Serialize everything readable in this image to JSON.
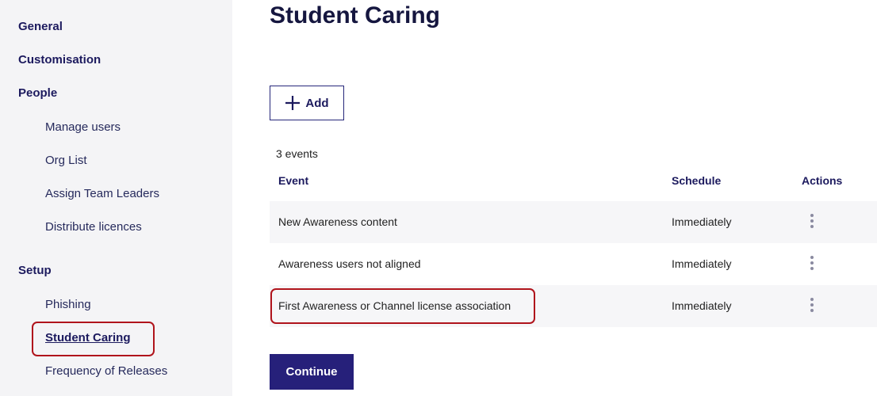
{
  "sidebar": {
    "sections": [
      {
        "label": "General"
      },
      {
        "label": "Customisation"
      },
      {
        "label": "People"
      },
      {
        "label": "Setup"
      }
    ],
    "items": [
      {
        "label": "Manage users"
      },
      {
        "label": "Org List"
      },
      {
        "label": "Assign Team Leaders"
      },
      {
        "label": "Distribute licences"
      },
      {
        "label": "Phishing"
      },
      {
        "label": "Student Caring"
      },
      {
        "label": "Frequency of Releases"
      }
    ]
  },
  "main": {
    "title": "Student Caring",
    "add_label": "Add",
    "count_text": "3 events",
    "columns": {
      "event": "Event",
      "schedule": "Schedule",
      "actions": "Actions"
    },
    "rows": [
      {
        "event": "New Awareness content",
        "schedule": "Immediately"
      },
      {
        "event": "Awareness users not aligned",
        "schedule": "Immediately"
      },
      {
        "event": "First Awareness or Channel license association",
        "schedule": "Immediately"
      }
    ],
    "continue_label": "Continue"
  },
  "icons": {
    "add": "plus-icon",
    "row_actions": "kebab-menu-icon"
  },
  "colors": {
    "accent": "#26207a",
    "highlight": "#b0141c",
    "sidebar_bg": "#f4f4f6"
  }
}
